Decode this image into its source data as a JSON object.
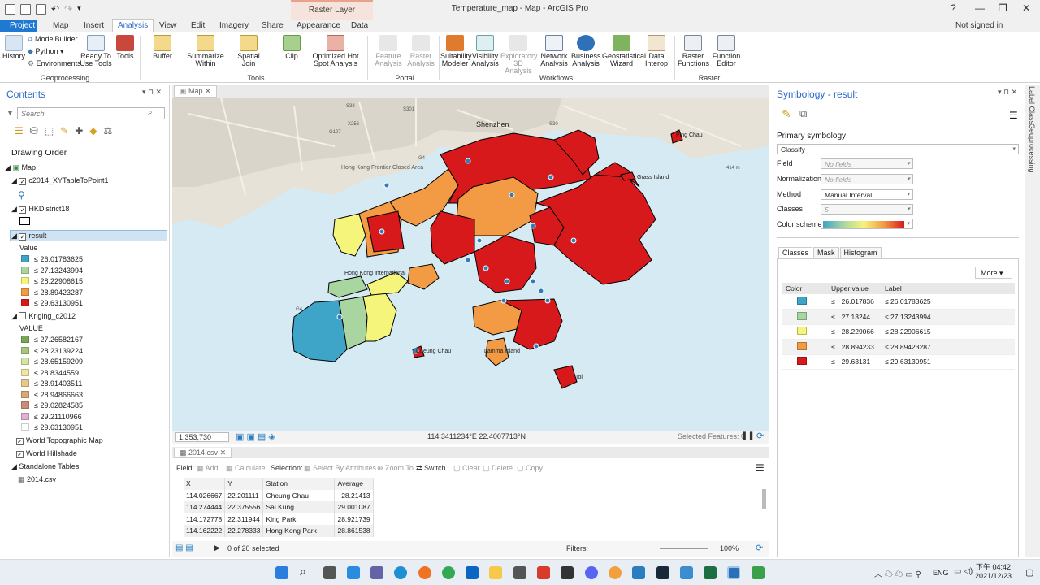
{
  "window": {
    "title": "Temperature_map - Map - ArcGIS Pro",
    "context_group": "Raster Layer",
    "help": "?",
    "signed_in": "Not signed in",
    "win_min": "—",
    "win_max": "❐",
    "win_close": "✕"
  },
  "ribbon_tabs": [
    "Project",
    "Map",
    "Insert",
    "Analysis",
    "View",
    "Edit",
    "Imagery",
    "Share",
    "Appearance",
    "Data"
  ],
  "ribbon": {
    "geoprocessing": {
      "history": "History",
      "modelbuilder": "ModelBuilder",
      "python": "Python",
      "environments": "Environments",
      "ready_to_use": "Ready To Use Tools",
      "tools": "Tools",
      "group": "Geoprocessing"
    },
    "tools_group": {
      "buffer": "Buffer",
      "summarize_within": "Summarize Within",
      "spatial_join": "Spatial Join",
      "clip": "Clip",
      "optimized_hot_spot": "Optimized Hot Spot Analysis",
      "group": "Tools"
    },
    "portal": {
      "feature_analysis": "Feature Analysis",
      "raster_analysis": "Raster Analysis",
      "group": "Portal"
    },
    "workflows": {
      "suitability_modeler": "Suitability Modeler",
      "visibility_analysis": "Visibility Analysis",
      "exploratory_3d": "Exploratory 3D Analysis",
      "network_analysis": "Network Analysis",
      "business_analysis": "Business Analysis",
      "geostatistical_wizard": "Geostatistical Wizard",
      "data_interop": "Data Interop",
      "group": "Workflows"
    },
    "raster": {
      "raster_functions": "Raster Functions",
      "function_editor": "Function Editor",
      "group": "Raster"
    }
  },
  "contents": {
    "title": "Contents",
    "search_placeholder": "Search",
    "drawing_order": "Drawing Order",
    "map_name": "Map",
    "layer1": "c2014_XYTableToPoint1",
    "layer2": "HKDistrict18",
    "layer3": "result",
    "layer3_field": "Value",
    "result_classes": [
      {
        "label": "≤ 26.01783625",
        "color": "#3ea4c8"
      },
      {
        "label": "≤ 27.13243994",
        "color": "#a9d6a0"
      },
      {
        "label": "≤ 28.22906615",
        "color": "#f4f57a"
      },
      {
        "label": "≤ 28.89423287",
        "color": "#f39a44"
      },
      {
        "label": "≤ 29.63130951",
        "color": "#d7191c"
      }
    ],
    "layer4": "Kriging_c2012",
    "layer4_field": "VALUE",
    "kriging_classes": [
      {
        "label": "≤ 27.26582167",
        "color": "#76a855"
      },
      {
        "label": "≤ 28.23139224",
        "color": "#a7c67c"
      },
      {
        "label": "≤ 28.65159209",
        "color": "#d6e3a6"
      },
      {
        "label": "≤ 28.8344559",
        "color": "#efe6a4"
      },
      {
        "label": "≤ 28.91403511",
        "color": "#e6c98a"
      },
      {
        "label": "≤ 28.94866663",
        "color": "#d9a874"
      },
      {
        "label": "≤ 29.02824585",
        "color": "#c88d7a"
      },
      {
        "label": "≤ 29.21110966",
        "color": "#e2b2d1"
      },
      {
        "label": "≤ 29.63130951",
        "color": "#ffffff"
      }
    ],
    "layer5": "World Topographic Map",
    "layer6": "World Hillshade",
    "standalone_tables": "Standalone Tables",
    "table1": "2014.csv"
  },
  "map": {
    "tab": "Map",
    "labels": {
      "shenzhen": "Shenzhen",
      "ping_chau": "Ping Chau",
      "grass_island": "Grass Island",
      "hk_frontier": "Hong Kong Frontier Closed Area",
      "hk_airport": "Hong Kong International",
      "cheung_chau": "Cheung Chau",
      "lamma_island": "Lamma Island",
      "po_toi": "Toi",
      "road_s33": "S33",
      "road_s301": "S301",
      "road_x256": "X256",
      "road_g107": "G107",
      "road_g4_top": "G4",
      "road_g4_left": "G4",
      "road_s30": "S30",
      "road_414m": "414 m"
    },
    "scale": "1:353,730",
    "coords": "114.3411234°E 22.4007713°N",
    "selected_features": "Selected Features: 0"
  },
  "attribute_table": {
    "tab": "2014.csv",
    "field_label": "Field:",
    "add": "Add",
    "calculate": "Calculate",
    "selection_label": "Selection:",
    "select_by_attributes": "Select By Attributes",
    "zoom_to": "Zoom To",
    "switch": "Switch",
    "clear": "Clear",
    "delete": "Delete",
    "copy": "Copy",
    "columns": [
      "X",
      "Y",
      "Station",
      "Average"
    ],
    "rows": [
      [
        "114.026667",
        "22.201111",
        "Cheung Chau",
        "28.21413"
      ],
      [
        "114.274444",
        "22.375556",
        "Sai Kung",
        "29.001087"
      ],
      [
        "114.172778",
        "22.311944",
        "King Park",
        "28.921739"
      ],
      [
        "114.162222",
        "22.278333",
        "Hong Kong Park",
        "28.861538"
      ]
    ],
    "selected": "0 of 20 selected",
    "filters": "Filters:",
    "zoom": "100%"
  },
  "symbology": {
    "title": "Symbology - result",
    "primary": "Primary symbology",
    "method_type": "Classify",
    "field_label": "Field",
    "field_value": "No fields",
    "normalization_label": "Normalization",
    "normalization_value": "No fields",
    "method_label": "Method",
    "method_value": "Manual Interval",
    "classes_label": "Classes",
    "classes_value": "5",
    "scheme_label": "Color scheme",
    "tabs": [
      "Classes",
      "Mask",
      "Histogram"
    ],
    "more": "More",
    "col_color": "Color",
    "col_upper": "Upper value",
    "col_label": "Label",
    "rows": [
      {
        "color": "#3ea4c8",
        "upper": "26.017836",
        "label": "≤ 26.01783625"
      },
      {
        "color": "#a9d6a0",
        "upper": "27.13244",
        "label": "≤ 27.13243994"
      },
      {
        "color": "#f4f57a",
        "upper": "28.229066",
        "label": "≤ 28.22906615"
      },
      {
        "color": "#f39a44",
        "upper": "28.894233",
        "label": "≤ 28.89423287"
      },
      {
        "color": "#d7191c",
        "upper": "29.63131",
        "label": "≤ 29.63130951"
      }
    ],
    "le": "≤"
  },
  "side_strip": {
    "label_class": "Label Class",
    "geoprocessing": "Geoprocessing"
  },
  "taskbar": {
    "lang": "ENG",
    "time": "下午 04:42",
    "date": "2021/12/23"
  }
}
